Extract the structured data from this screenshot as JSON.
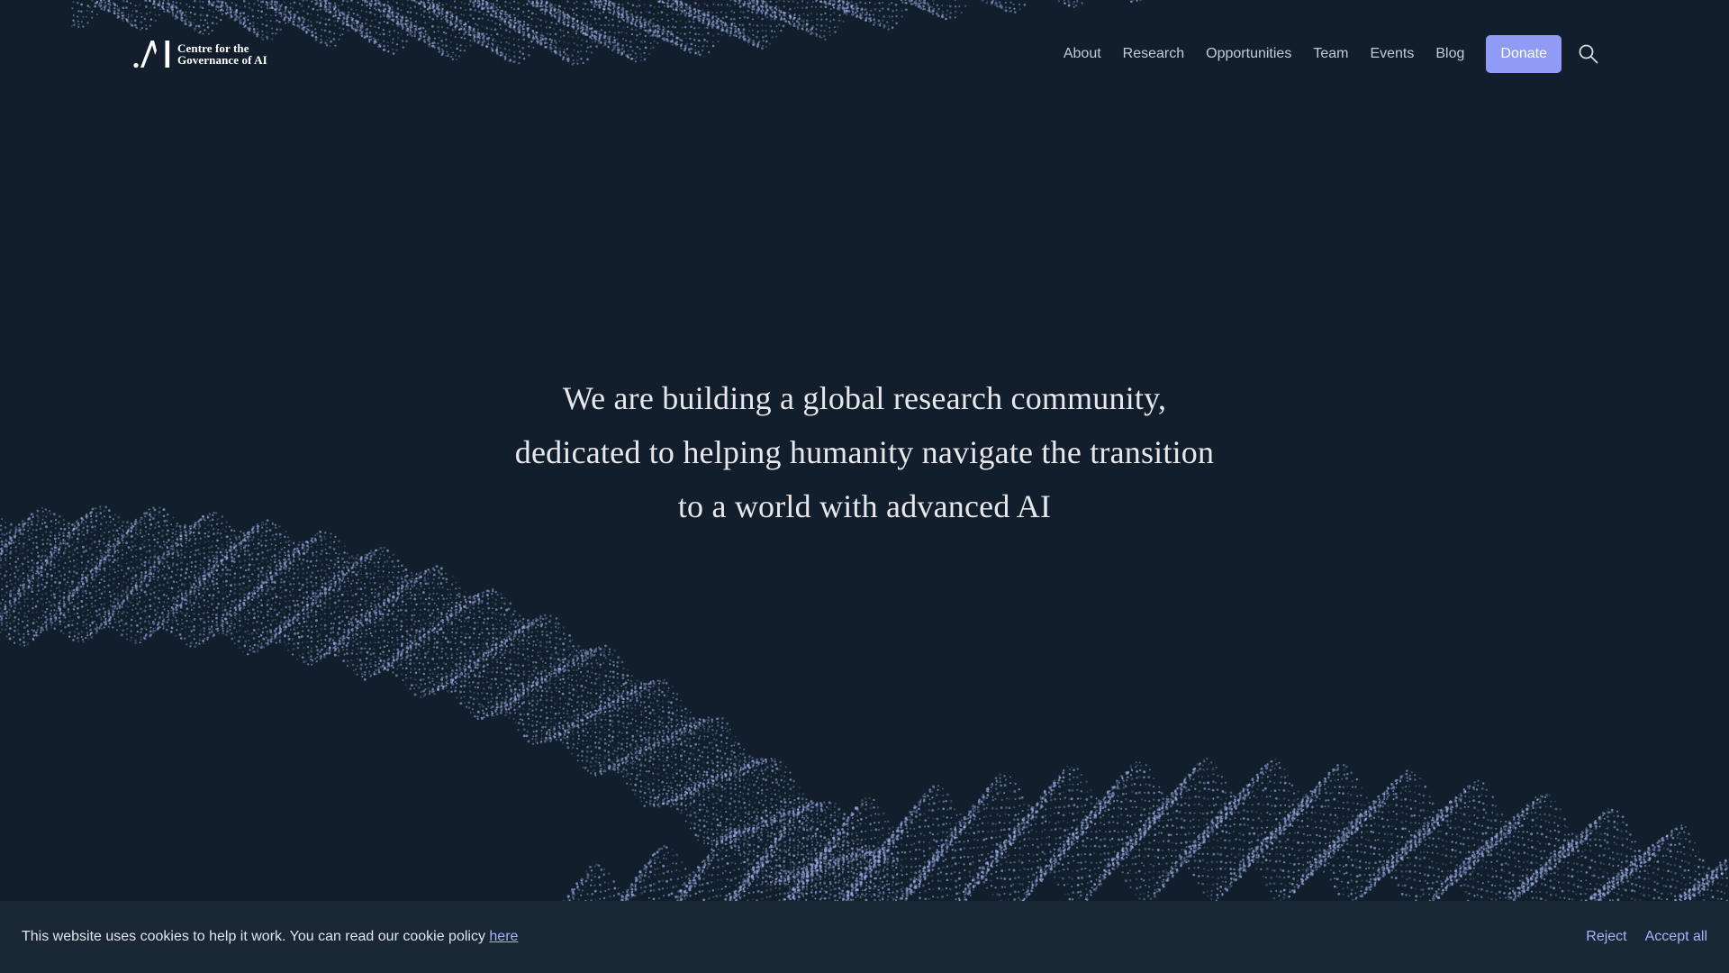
{
  "header": {
    "logo": {
      "line1": "Centre for the",
      "line2": "Governance of AI"
    },
    "nav": [
      {
        "label": "About"
      },
      {
        "label": "Research"
      },
      {
        "label": "Opportunities"
      },
      {
        "label": "Team"
      },
      {
        "label": "Events"
      },
      {
        "label": "Blog"
      }
    ],
    "donate_label": "Donate",
    "search_icon": "search-icon"
  },
  "hero": {
    "lines": [
      "We are building a global research community,",
      "dedicated to helping humanity navigate the transition",
      "to a world with advanced AI"
    ]
  },
  "cookie_banner": {
    "text": "This website uses cookies to help it work. You can read our cookie policy ",
    "link_label": "here",
    "reject_label": "Reject",
    "accept_label": "Accept all"
  },
  "colors": {
    "background": "#121e2b",
    "accent": "#8f9bf4",
    "link": "#a9b2f8",
    "nav_text": "#c5cbd4",
    "banner_background": "#1a2735"
  }
}
